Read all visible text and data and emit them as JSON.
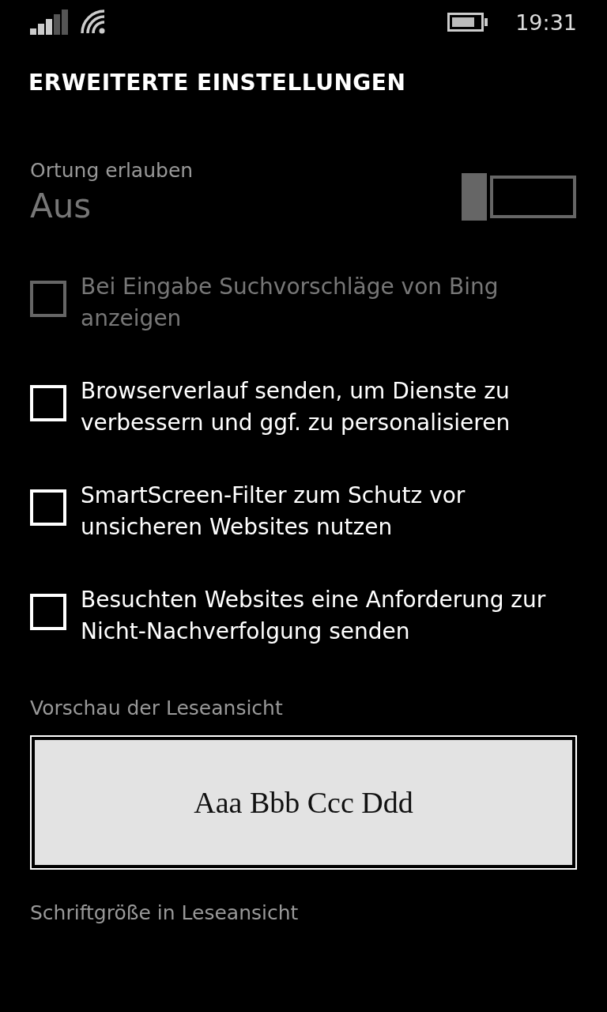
{
  "status_bar": {
    "time": "19:31"
  },
  "title": "ERWEITERTE EINSTELLUNGEN",
  "location": {
    "label": "Ortung erlauben",
    "value": "Aus",
    "on": false,
    "disabled": true
  },
  "options": [
    {
      "label": "Bei Eingabe Suchvorschläge von Bing anzeigen",
      "checked": false,
      "disabled": true
    },
    {
      "label": "Browserverlauf senden, um Dienste zu verbessern und ggf. zu personalisieren",
      "checked": false,
      "disabled": false
    },
    {
      "label": "SmartScreen-Filter zum Schutz vor unsicheren Websites nutzen",
      "checked": false,
      "disabled": false
    },
    {
      "label": "Besuchten Websites eine Anforderung zur Nicht-Nachverfolgung senden",
      "checked": false,
      "disabled": false
    }
  ],
  "preview": {
    "label": "Vorschau der Leseansicht",
    "sample": "Aaa Bbb Ccc Ddd"
  },
  "font_size": {
    "label": "Schriftgröße in Leseansicht"
  }
}
